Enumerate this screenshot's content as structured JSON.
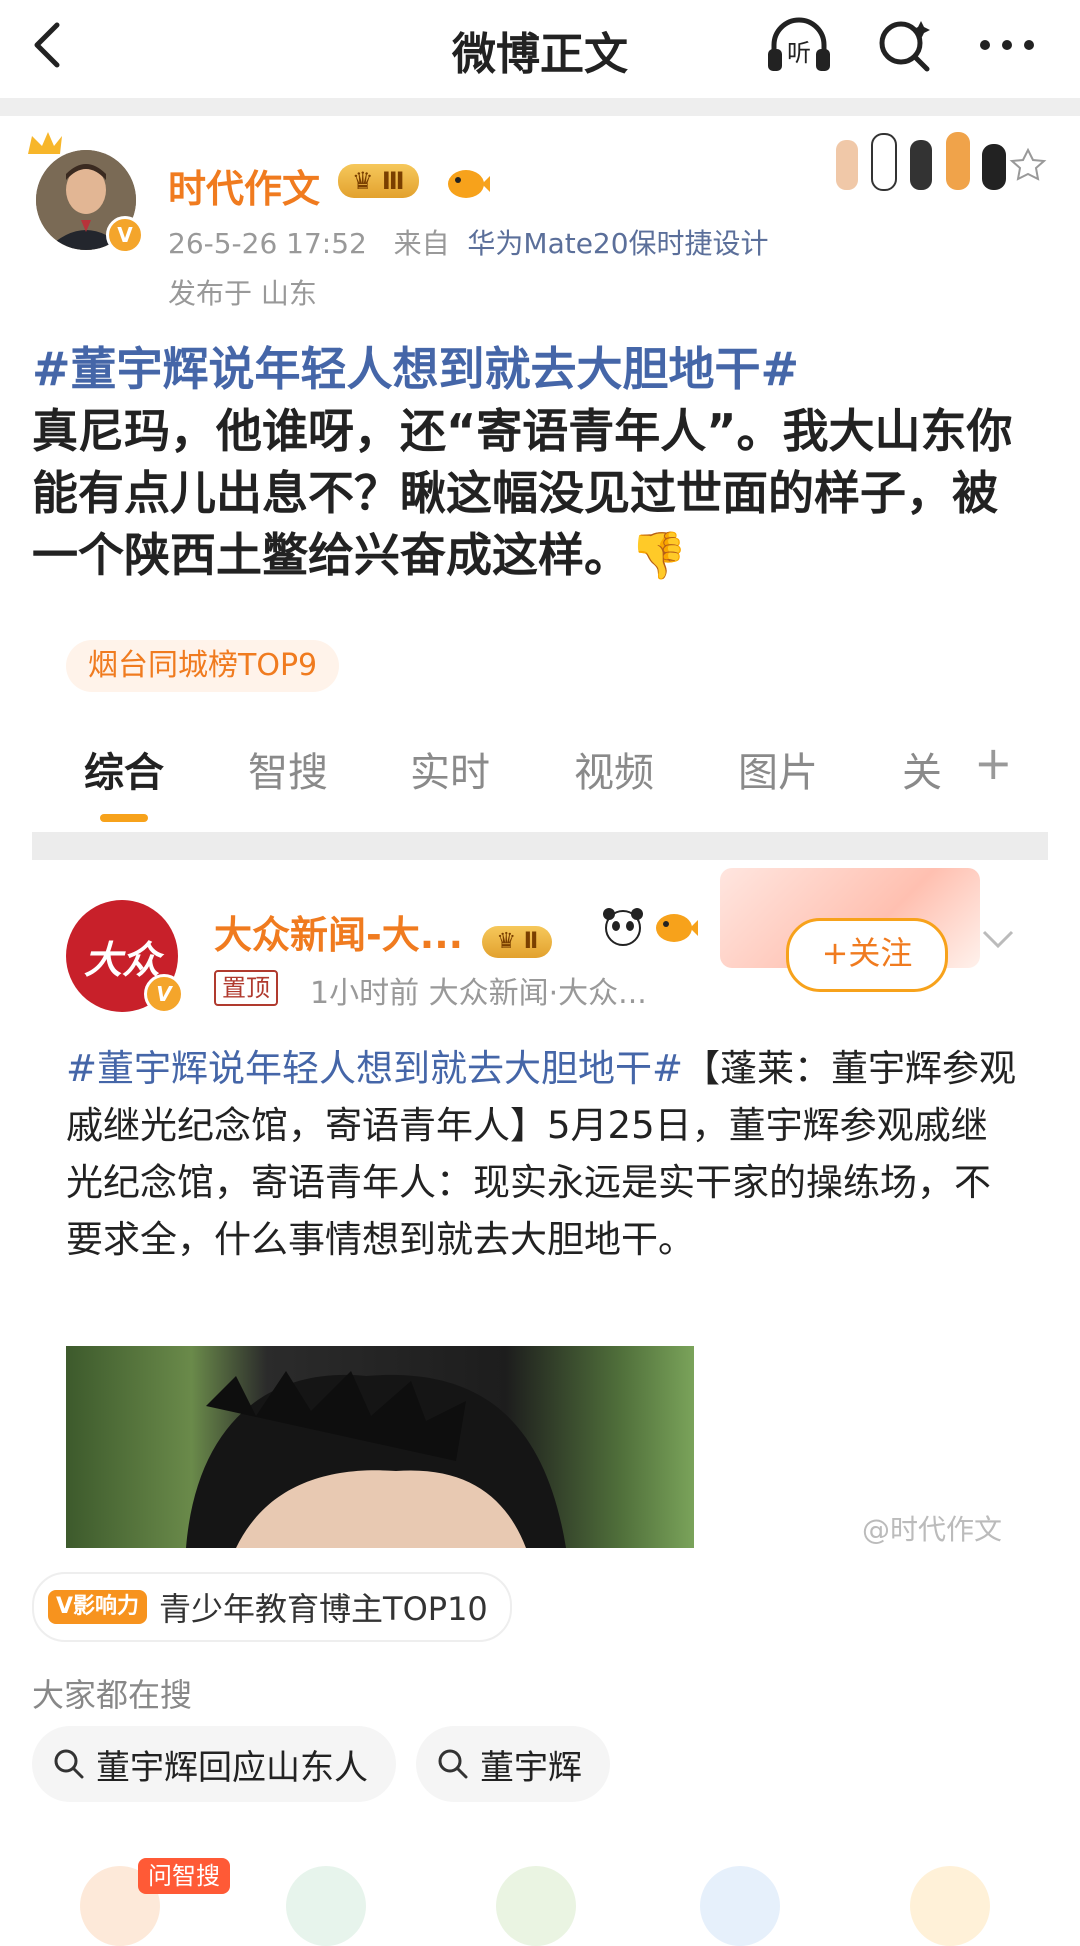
{
  "header": {
    "title": "微博正文",
    "listen_label": "听"
  },
  "post": {
    "author": "时代作文",
    "author_level": "Ⅲ",
    "time": "26-5-26 17:52",
    "source_prefix": "来自",
    "device": "华为Mate20保时捷设计",
    "location": "发布于 山东",
    "topic": "#董宇辉说年轻人想到就去大胆地干#",
    "text": "真尼玛，他谁呀，还“寄语青年人”。我大山东你能有点儿出息不？瞅这幅没见过世面的样子，被一个陕西土鳖给兴奋成这样。",
    "emoji": "👎",
    "rank_tag": "烟台同城榜TOP9"
  },
  "tabs": [
    {
      "label": "综合"
    },
    {
      "label": "智搜"
    },
    {
      "label": "实时"
    },
    {
      "label": "视频"
    },
    {
      "label": "图片"
    },
    {
      "label": "关"
    }
  ],
  "card": {
    "name": "大众新闻-大...",
    "level": "Ⅱ",
    "avatar_text": "大众",
    "pinned": "置顶",
    "meta": "1小时前  大众新闻·大众...",
    "follow_label": "+关注",
    "topic": "#董宇辉说年轻人想到就去大胆地干#",
    "text": "【蓬莱：董宇辉参观戚继光纪念馆，寄语青年人】5月25日，董宇辉参观戚继光纪念馆，寄语青年人：现实永远是实干家的操练场，不要求全，什么事情想到就去大胆地干。",
    "watermark": "@时代作文",
    "influence_tag": "V影响力",
    "influence_text": "青少年教育博主TOP10"
  },
  "search": {
    "heading": "大家都在搜",
    "chips": [
      "董宇辉回应山东人",
      "董宇辉"
    ]
  },
  "bottom": {
    "ask_label": "问智搜"
  },
  "colors": {
    "accent": "#f07b1f",
    "topic": "#4566a8",
    "tab_underline": "#f7a21b"
  }
}
